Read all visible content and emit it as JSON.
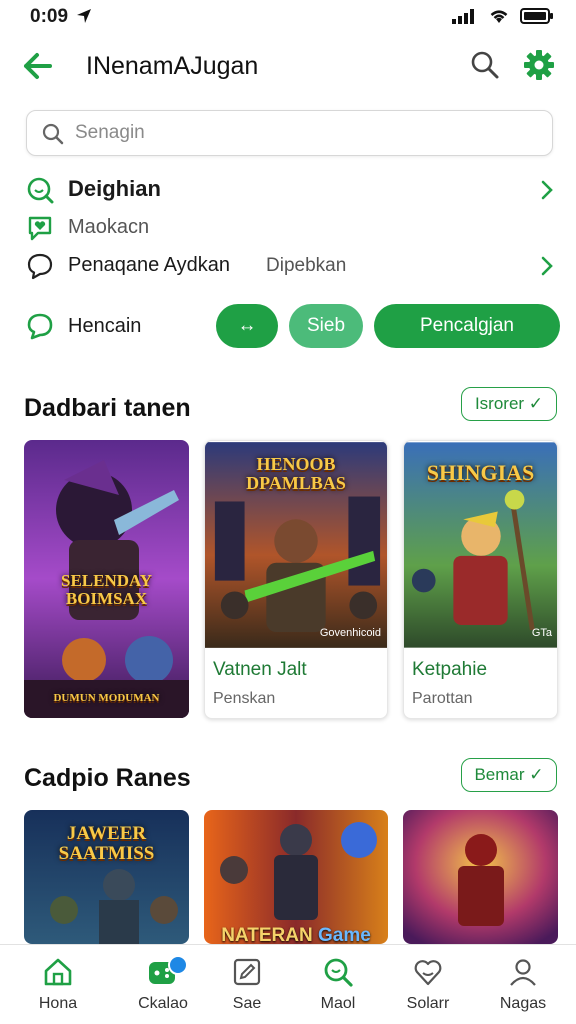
{
  "status": {
    "time": "0:09"
  },
  "app_bar": {
    "title": "INenamAJugan"
  },
  "search": {
    "placeholder": "Senagin"
  },
  "rows": [
    {
      "label": "Deighian",
      "icon": "search-face-icon"
    },
    {
      "label": "Maokacn",
      "icon": "chat-heart-icon"
    },
    {
      "label": "Penaqane Aydkan",
      "extra": "Dipebkan",
      "icon": "chat-bubble-icon"
    }
  ],
  "filter_row": {
    "label": "Hencain",
    "pills": {
      "arrows": "↔",
      "small": "Sieb",
      "large": "Pencalgjan"
    }
  },
  "section1": {
    "title": "Dadbari tanen",
    "see_label": "Isrorer ✓",
    "cards": [
      {
        "art_title": "SELENDAY BOIMSAX",
        "art_bottom": "DUMUN MODUMAN"
      },
      {
        "art_title": "HENOOB DPAMLBAS",
        "art_bottom": "Govenhicoid",
        "name": "Vatnen Jalt",
        "sub": "Penskan"
      },
      {
        "art_title": "SHINGIAS",
        "art_bottom": "GTa",
        "name": "Ketpahie",
        "sub": "Parottan"
      }
    ]
  },
  "section2": {
    "title": "Cadpio Ranes",
    "see_label": "Bemar ✓",
    "cards": [
      {
        "art_title": "JAWEER SAATMISS"
      },
      {
        "art_title": "NATERAN",
        "art_title2": "Game"
      },
      {
        "art_title": ""
      }
    ]
  },
  "bottom_nav": [
    {
      "label": "Hona",
      "icon": "home-icon"
    },
    {
      "label": "Ckalao",
      "icon": "game-controller-icon"
    },
    {
      "label": "Sae",
      "icon": "edit-icon"
    },
    {
      "label": "Maol",
      "icon": "search-icon"
    },
    {
      "label": "Solarr",
      "icon": "heart-face-icon"
    },
    {
      "label": "Nagas",
      "icon": "profile-icon"
    }
  ],
  "colors": {
    "accent": "#1fa045",
    "accent_light": "#4cbb7a",
    "badge": "#1e88e5"
  }
}
